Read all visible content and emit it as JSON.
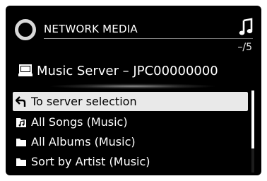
{
  "header": {
    "title": "NETWORK MEDIA",
    "app_icon": "network-ring-icon",
    "mode_icon": "music-note-icon",
    "count": "–/5"
  },
  "server": {
    "icon": "server-icon",
    "name": "Music Server – JPC00000000"
  },
  "list": {
    "items": [
      {
        "label": "To server selection",
        "icon": "back-arrow-icon",
        "selected": true
      },
      {
        "label": "All Songs (Music)",
        "icon": "music-folder-icon",
        "selected": false
      },
      {
        "label": "All Albums (Music)",
        "icon": "folder-icon",
        "selected": false
      },
      {
        "label": "Sort by Artist (Music)",
        "icon": "folder-icon",
        "selected": false
      }
    ]
  },
  "colors": {
    "background": "#000000",
    "text": "#ffffff",
    "selected_bg": "#e9e9e9",
    "selected_text": "#000000"
  }
}
